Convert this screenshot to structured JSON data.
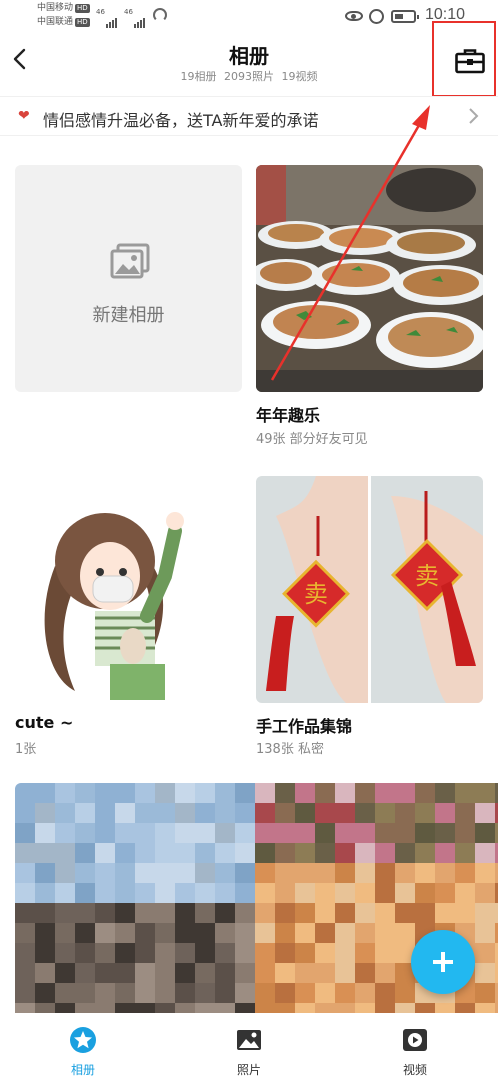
{
  "status_bar": {
    "carrier1": "中国移动",
    "carrier2": "中国联通",
    "hd": "HD",
    "net1": "46",
    "net2": "46",
    "time": "10:10"
  },
  "header": {
    "title": "相册",
    "stats": [
      "19相册",
      "2093照片",
      "19视频"
    ],
    "toolbox_icon": "toolbox-icon",
    "back_icon": "back-arrow-icon"
  },
  "banner": {
    "icon": "heart-icon",
    "text": "情侣感情升温必备，送TA新年爱的承诺"
  },
  "albums": [
    {
      "name": "新建相册",
      "meta": ""
    },
    {
      "name": "年年趣乐",
      "meta": "49张  部分好友可见"
    },
    {
      "name": "cute ~",
      "meta": "1张"
    },
    {
      "name": "手工作品集锦",
      "meta": "138张  私密"
    }
  ],
  "fab": {
    "icon": "plus-icon"
  },
  "bottom_nav": [
    {
      "label": "相册",
      "icon": "album-star-icon",
      "active": true
    },
    {
      "label": "照片",
      "icon": "photo-icon",
      "active": false
    },
    {
      "label": "视频",
      "icon": "video-icon",
      "active": false
    }
  ],
  "colors": {
    "accent": "#1aa0e0",
    "fab": "#22b8f0",
    "highlight": "#e8312b"
  }
}
